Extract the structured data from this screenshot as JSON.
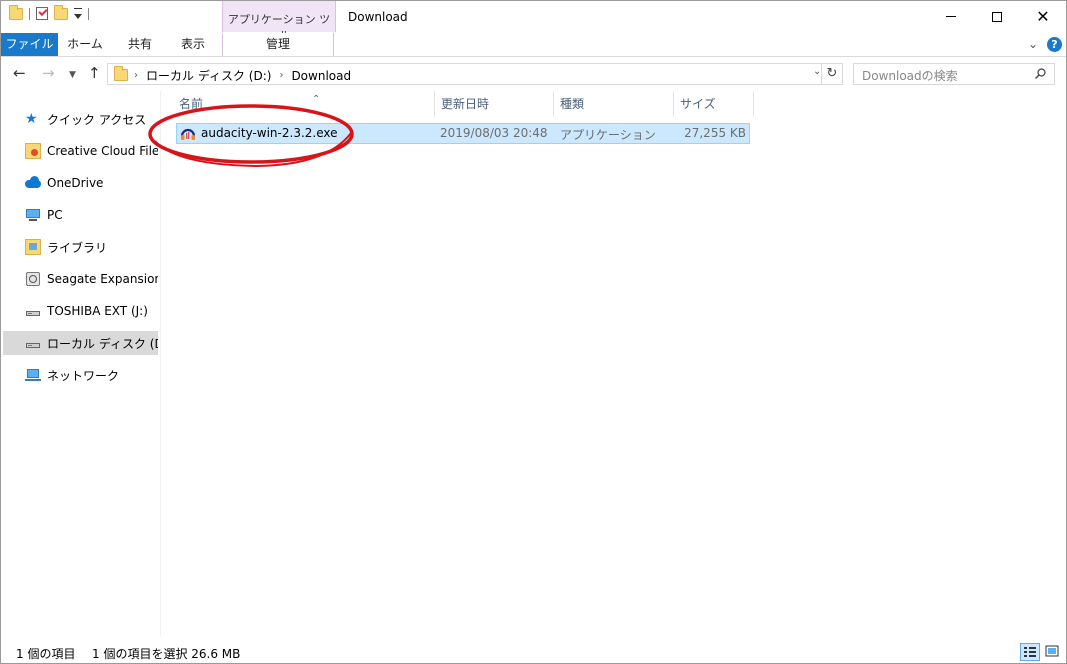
{
  "window": {
    "title": "Download",
    "context_tab_group": "アプリケーション ツール"
  },
  "ribbon": {
    "tabs": [
      "ファイル",
      "ホーム",
      "共有",
      "表示",
      "管理"
    ],
    "accent_color": "#1979ca",
    "context_color": "#f1e4f7"
  },
  "address": {
    "crumbs": [
      "ローカル ディスク (D:)",
      "Download"
    ],
    "search_placeholder": "Downloadの検索"
  },
  "sidebar": {
    "items": [
      {
        "label": "クイック アクセス",
        "icon": "star-icon"
      },
      {
        "label": "Creative Cloud Files",
        "icon": "creative-cloud-folder-icon"
      },
      {
        "label": "OneDrive",
        "icon": "onedrive-cloud-icon"
      },
      {
        "label": "PC",
        "icon": "pc-icon"
      },
      {
        "label": "ライブラリ",
        "icon": "library-icon"
      },
      {
        "label": "Seagate Expansion Drive",
        "icon": "hdd-icon"
      },
      {
        "label": "TOSHIBA EXT (J:)",
        "icon": "drive-icon"
      },
      {
        "label": "ローカル ディスク (D:)",
        "icon": "drive-icon",
        "selected": true
      },
      {
        "label": "ネットワーク",
        "icon": "network-icon"
      }
    ]
  },
  "columns": {
    "name": "名前",
    "date": "更新日時",
    "type": "種類",
    "size": "サイズ"
  },
  "files": [
    {
      "name": "audacity-win-2.3.2.exe",
      "date": "2019/08/03 20:48",
      "type": "アプリケーション",
      "size": "27,255 KB",
      "selected": true
    }
  ],
  "status": {
    "count": "1 個の項目",
    "selected": "1 個の項目を選択  26.6 MB"
  },
  "annotation_color": "#d8141b"
}
